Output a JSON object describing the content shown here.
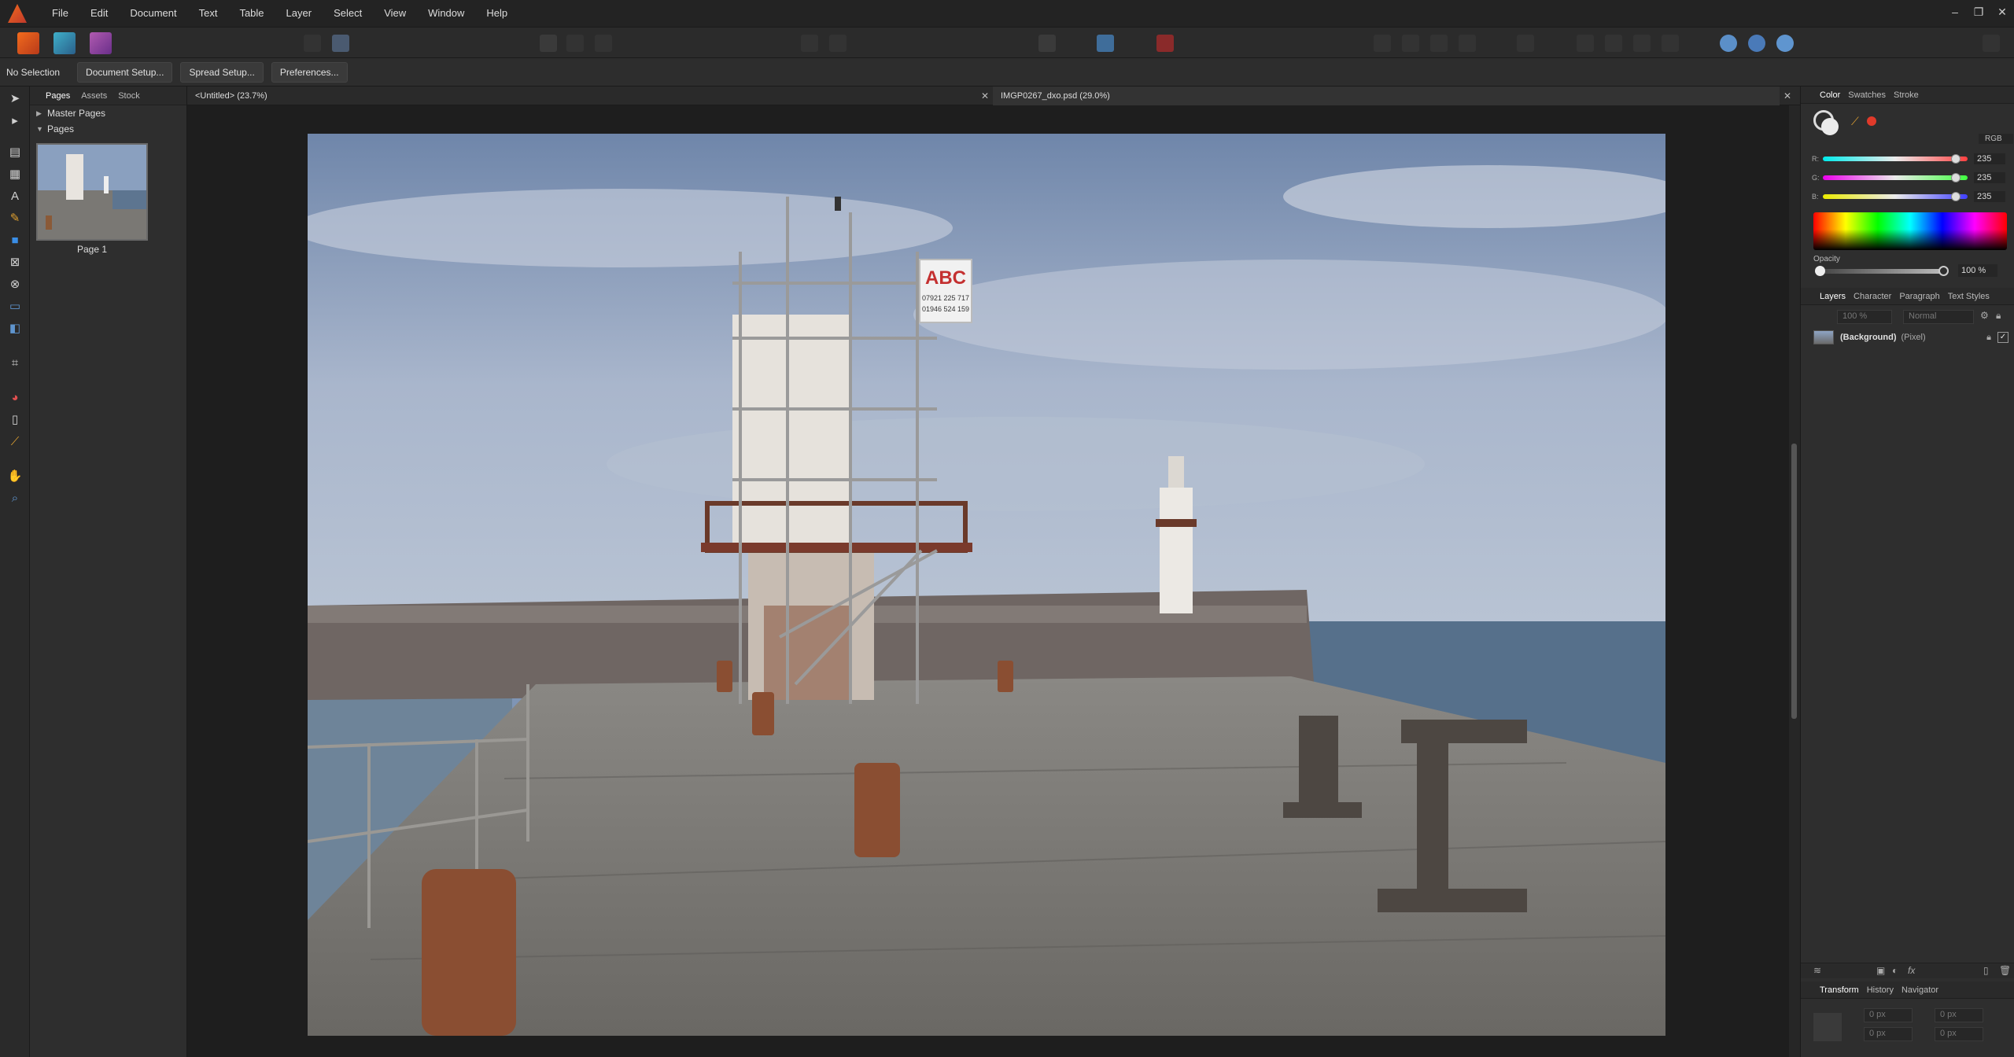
{
  "menu": [
    "File",
    "Edit",
    "Document",
    "Text",
    "Table",
    "Layer",
    "Select",
    "View",
    "Window",
    "Help"
  ],
  "window_controls": [
    "–",
    "❐",
    "✕"
  ],
  "context_bar": {
    "selection": "No Selection",
    "buttons": [
      "Document Setup...",
      "Spread Setup...",
      "Preferences..."
    ]
  },
  "pages_panel": {
    "tabs": [
      "Pages",
      "Assets",
      "Stock"
    ],
    "master_pages": "Master Pages",
    "pages": "Pages",
    "page_label": "Page 1"
  },
  "documents": {
    "tab1": "<Untitled> (23.7%)",
    "tab2": "IMGP0267_dxo.psd (29.0%)",
    "close": "✕"
  },
  "color_panel": {
    "tabs": [
      "Color",
      "Swatches",
      "Stroke"
    ],
    "model": "RGB",
    "r": "235",
    "g": "235",
    "b": "235",
    "r_level": 0.92,
    "g_level": 0.92,
    "b_level": 0.92,
    "opacity_label": "Opacity",
    "opacity": "100 %"
  },
  "layers_panel": {
    "tabs": [
      "Layers",
      "Character",
      "Paragraph",
      "Text Styles"
    ],
    "opacity": "100 %",
    "blend": "Normal",
    "layer_name": "(Background)",
    "layer_type": "(Pixel)"
  },
  "transform_panel": {
    "tabs": [
      "Transform",
      "History",
      "Navigator"
    ],
    "fields": [
      "0 px",
      "0 px",
      "0 px",
      "0 px"
    ]
  },
  "photo": {
    "sign_text": "ABC",
    "sign_line1": "07921 225 717",
    "sign_line2": "01946 524 159"
  },
  "colors": {
    "accent": "#3a8ee6",
    "sky_top": "#7f95b5",
    "sea": "#55708a",
    "pier": "#7d7b78"
  }
}
